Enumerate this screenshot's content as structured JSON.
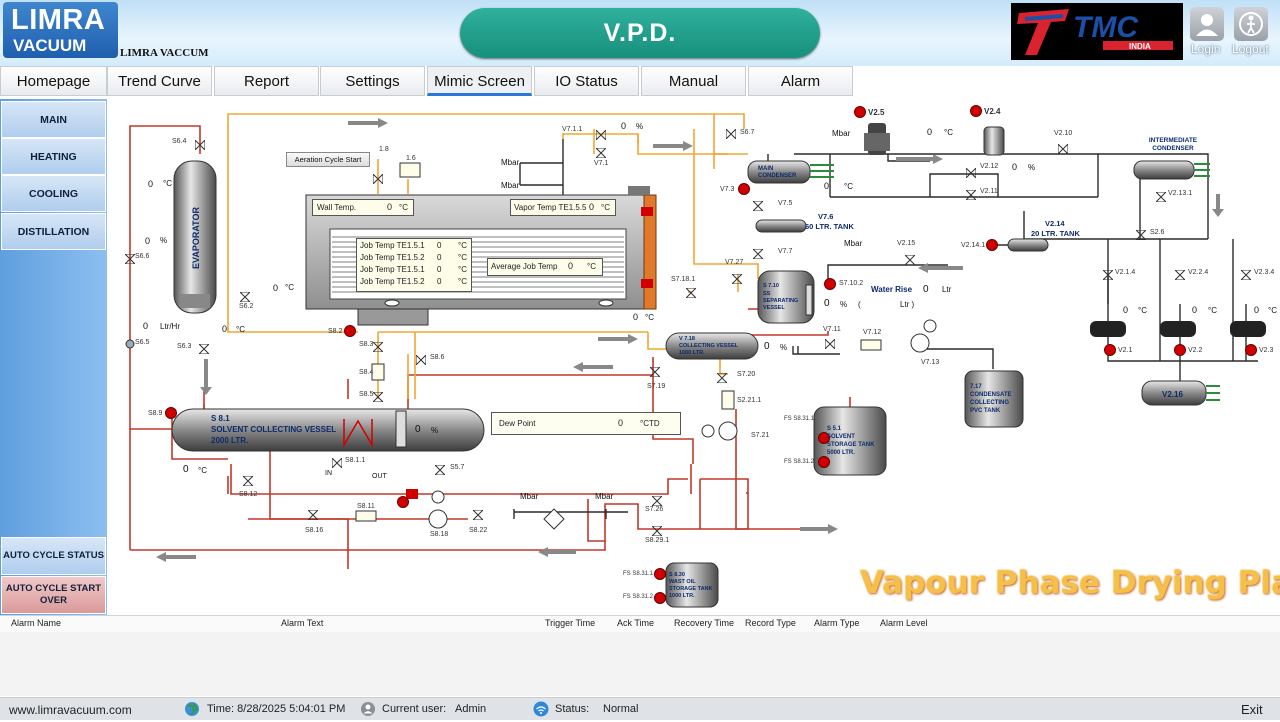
{
  "header": {
    "logo_line1": "LIMRA",
    "logo_line2": "VACUUM",
    "company_name": "LIMRA VACCUM",
    "title": "V.P.D.",
    "brand_logo": "TMC",
    "brand_sub": "INDIA",
    "login_label": "Login",
    "logout_label": "Logout",
    "login_icon": "user-icon",
    "logout_icon": "exit-person-icon"
  },
  "nav": {
    "tabs": [
      "Homepage",
      "Trend Curve",
      "Report",
      "Settings",
      "Mimic Screen",
      "IO Status",
      "Manual",
      "Alarm"
    ],
    "active": "Mimic Screen"
  },
  "sidebar": {
    "items": [
      "MAIN",
      "HEATING",
      "COOLING",
      "DISTILLATION"
    ],
    "auto_cycle_status": "AUTO CYCLE STATUS",
    "auto_cycle_start_over": "AUTO CYCLE START OVER"
  },
  "mimic": {
    "watermark": "Vapour Phase Drying Plant",
    "evaporator": "EVAPORATOR",
    "evap_temp": "0",
    "evap_level": "0",
    "flow_value": "0",
    "flow_unit": "Ltr/Hr",
    "s63_temp": "0",
    "s62_temp": "0",
    "aeration_button": "Aeration Cycle Start",
    "wall_temp_label": "Wall Temp.",
    "wall_temp": "0",
    "vapor_temp_label": "Vapor Temp TE1.5.5",
    "vapor_temp": "0",
    "job_temps": [
      {
        "label": "Job Temp TE1.5.1",
        "value": "0"
      },
      {
        "label": "Job Temp TE1.5.2",
        "value": "0"
      },
      {
        "label": "Job Temp TE1.5.1",
        "value": "0"
      },
      {
        "label": "Job Temp TE1.5.2",
        "value": "0"
      }
    ],
    "avg_job_temp_label": "Average Job Temp",
    "avg_job_temp": "0",
    "autoclave_bottom_temp": "0",
    "solvent_vessel": {
      "tag": "S 8.1",
      "line1": "SOLVENT COLLECTING VESSEL",
      "line2": "2000 LTR.",
      "level": "0",
      "temp": "0"
    },
    "dew_point_label": "Dew Point",
    "dew_point": "0",
    "dew_point_unit": "°CTD",
    "v71_level": "0",
    "main_condenser": "MAIN CONDENSER",
    "main_cond_temp": "0",
    "top_temp": "0",
    "v212_level": "0",
    "tank_76": {
      "tag": "V7.6",
      "name": "60 LTR. TANK"
    },
    "tank_214": {
      "tag": "V2.14",
      "name": "20 LTR. TANK"
    },
    "separating": {
      "tag": "S 7.10",
      "l1": "SS",
      "l2": "SEPARATING",
      "l3": "VESSEL",
      "level": "0"
    },
    "water_rise_label": "Water Rise",
    "water_rise_value": "0",
    "water_rise_unit": "Ltr",
    "water_rise_paren_l": "(",
    "water_rise_paren_r": "Ltr )",
    "collecting_vessel": {
      "tag": "V 7.18",
      "l1": "COLLECTING VESSEL",
      "l2": "1000 LTR.",
      "level": "0"
    },
    "condensate": {
      "tag": "7.17",
      "l1": "CONDENSATE",
      "l2": "COLLECTING",
      "l3": "PVC TANK"
    },
    "solvent_storage": {
      "tag": "S 5.1",
      "l1": "SOLVENT",
      "l2": "STORAGE TANK",
      "l3": "5000 LTR."
    },
    "waste_oil": {
      "tag": "S 8.30",
      "l1": "WAST OIL",
      "l2": "STORAGE TANK",
      "l3": "1000 LTR."
    },
    "intermediate": "INTERMEDIATE CONDENSER",
    "v216": "V2.16",
    "pump_temps": [
      "0",
      "0",
      "0"
    ],
    "units": {
      "c": "°C",
      "pct": "%",
      "mbar": "Mbar",
      "in": "IN",
      "out": "OUT"
    },
    "tags": [
      "S6.4",
      "S6.6",
      "S6.5",
      "S6.3",
      "S6.2",
      "S8.9",
      "S8.2",
      "S8.3",
      "S8.4",
      "S8.5",
      "S8.6",
      "S8.1.1",
      "S5.7",
      "S8.12",
      "S8.16",
      "S8.11",
      "S8.18",
      "S8.22",
      "S7.26",
      "S8.29.1",
      "S7.19",
      "S7.18.1",
      "S7.20",
      "S2.21.1",
      "S7.21",
      "FS S8.31.1",
      "FS S8.31.2",
      "FS S8.31.1",
      "FS S8.31.2",
      "V7.1.1",
      "V7.1",
      "S6.7",
      "V7.3",
      "V7.5",
      "V7.7",
      "V7.27",
      "V2.5",
      "V2.4",
      "V2.10",
      "V2.12",
      "V2.11",
      "V2.15",
      "V2.14.1",
      "S7.10.2",
      "V7.11",
      "V7.12",
      "V7.13",
      "V2.13.1",
      "S2.6",
      "V2.1.4",
      "V2.2.4",
      "V2.3.4",
      "V2.1",
      "V2.2",
      "V2.3",
      "1.8",
      "1.6"
    ]
  },
  "alarm_table": {
    "columns": [
      "Alarm Name",
      "Alarm Text",
      "Trigger Time",
      "Ack Time",
      "Recovery Time",
      "Record Type",
      "Alarm Type",
      "Alarm Level"
    ]
  },
  "footer": {
    "website": "www.limravacuum.com",
    "time": "Time: 8/28/2025 5:04:01 PM",
    "user_label": "Current user:",
    "user": "Admin",
    "status_label": "Status:",
    "status": "Normal",
    "exit": "Exit"
  },
  "colors": {
    "accent": "#2a78d6",
    "title_bg": "#1fa18d",
    "pipe_red": "#c0392b",
    "pipe_orange": "#f2a733",
    "alarm_red": "#d10000"
  }
}
